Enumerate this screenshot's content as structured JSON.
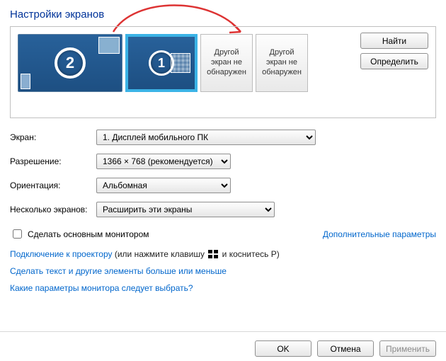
{
  "title": "Настройки экранов",
  "monitors": {
    "primaryNumber": "1",
    "secondaryNumber": "2",
    "other1": "Другой экран не обнаружен",
    "other2": "Другой экран не обнаружен"
  },
  "buttons": {
    "find": "Найти",
    "identify": "Определить",
    "ok": "OK",
    "cancel": "Отмена",
    "apply": "Применить"
  },
  "labels": {
    "screen": "Экран:",
    "resolution": "Разрешение:",
    "orientation": "Ориентация:",
    "multi": "Несколько экранов:",
    "makePrimary": "Сделать основным монитором",
    "advanced": "Дополнительные параметры"
  },
  "values": {
    "screen": "1. Дисплей мобильного ПК",
    "resolution": "1366 × 768 (рекомендуется)",
    "orientation": "Альбомная",
    "multi": "Расширить эти экраны"
  },
  "links": {
    "projectorA": "Подключение к проектору",
    "projectorB_prefix": " (или нажмите клавишу ",
    "projectorB_suffix": " и коснитесь P)",
    "textSize": "Сделать текст и другие элементы больше или меньше",
    "whichMonitor": "Какие параметры монитора следует выбрать?"
  }
}
